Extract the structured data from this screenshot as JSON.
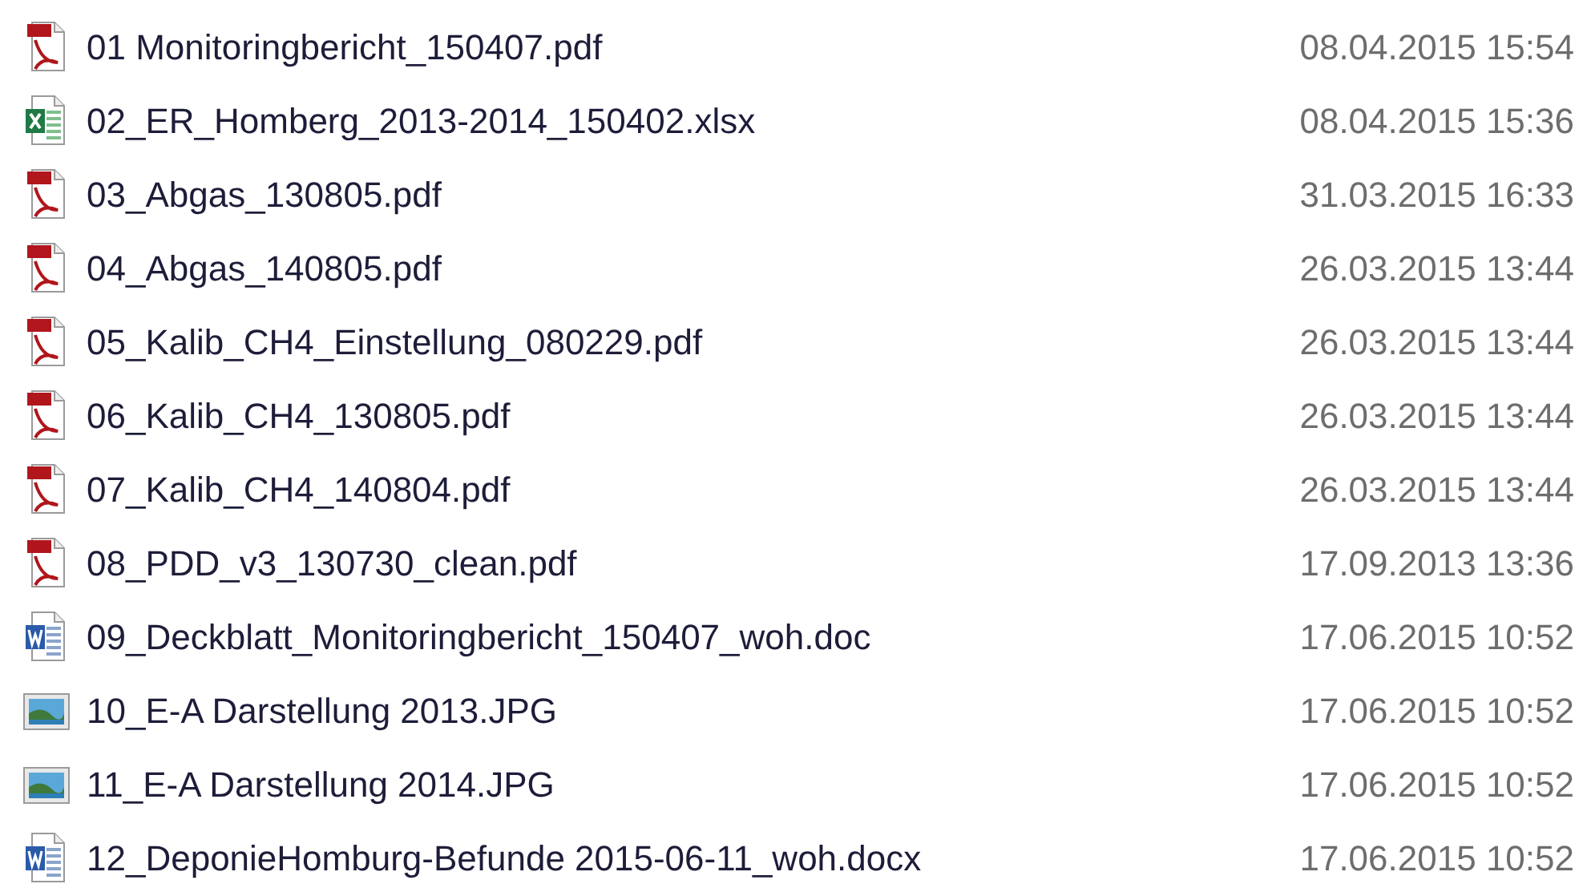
{
  "files": [
    {
      "kind": "pdf",
      "name": "01 Monitoringbericht_150407.pdf",
      "modified": "08.04.2015 15:54"
    },
    {
      "kind": "excel",
      "name": "02_ER_Homberg_2013-2014_150402.xlsx",
      "modified": "08.04.2015 15:36"
    },
    {
      "kind": "pdf",
      "name": "03_Abgas_130805.pdf",
      "modified": "31.03.2015 16:33"
    },
    {
      "kind": "pdf",
      "name": "04_Abgas_140805.pdf",
      "modified": "26.03.2015 13:44"
    },
    {
      "kind": "pdf",
      "name": "05_Kalib_CH4_Einstellung_080229.pdf",
      "modified": "26.03.2015 13:44"
    },
    {
      "kind": "pdf",
      "name": "06_Kalib_CH4_130805.pdf",
      "modified": "26.03.2015 13:44"
    },
    {
      "kind": "pdf",
      "name": "07_Kalib_CH4_140804.pdf",
      "modified": "26.03.2015 13:44"
    },
    {
      "kind": "pdf",
      "name": "08_PDD_v3_130730_clean.pdf",
      "modified": "17.09.2013 13:36"
    },
    {
      "kind": "word",
      "name": "09_Deckblatt_Monitoringbericht_150407_woh.doc",
      "modified": "17.06.2015 10:52"
    },
    {
      "kind": "image",
      "name": "10_E-A Darstellung 2013.JPG",
      "modified": "17.06.2015 10:52"
    },
    {
      "kind": "image",
      "name": "11_E-A Darstellung 2014.JPG",
      "modified": "17.06.2015 10:52"
    },
    {
      "kind": "word",
      "name": "12_DeponieHomburg-Befunde 2015-06-11_woh.docx",
      "modified": "17.06.2015 10:52"
    }
  ]
}
